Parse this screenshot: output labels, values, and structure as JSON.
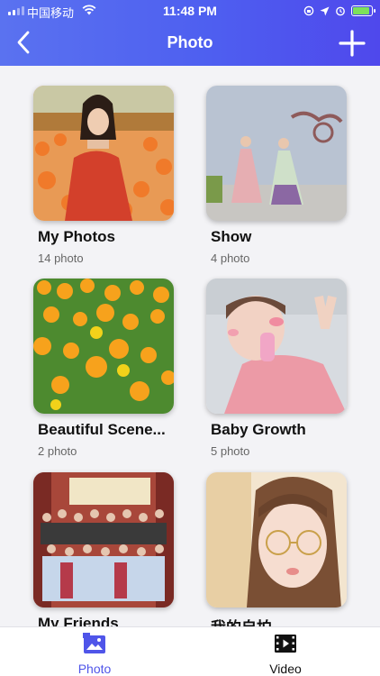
{
  "status_bar": {
    "carrier": "中国移动",
    "time": "11:48 PM"
  },
  "nav": {
    "title": "Photo"
  },
  "albums": [
    {
      "name": "My Photos",
      "count": "14 photo"
    },
    {
      "name": "Show",
      "count": "4 photo"
    },
    {
      "name": "Beautiful Scene...",
      "count": "2 photo"
    },
    {
      "name": "Baby Growth",
      "count": "5 photo"
    },
    {
      "name": "My Friends",
      "count": ""
    },
    {
      "name": "我的自拍",
      "count": ""
    }
  ],
  "tabs": [
    {
      "label": "Photo",
      "icon": "photo-icon",
      "active": true
    },
    {
      "label": "Video",
      "icon": "film-icon",
      "active": false
    }
  ],
  "colors": {
    "header_gradient_start": "#5a72f0",
    "header_gradient_end": "#4f48ec",
    "active_tab": "#4f55e9",
    "inactive_tab": "#111111"
  }
}
